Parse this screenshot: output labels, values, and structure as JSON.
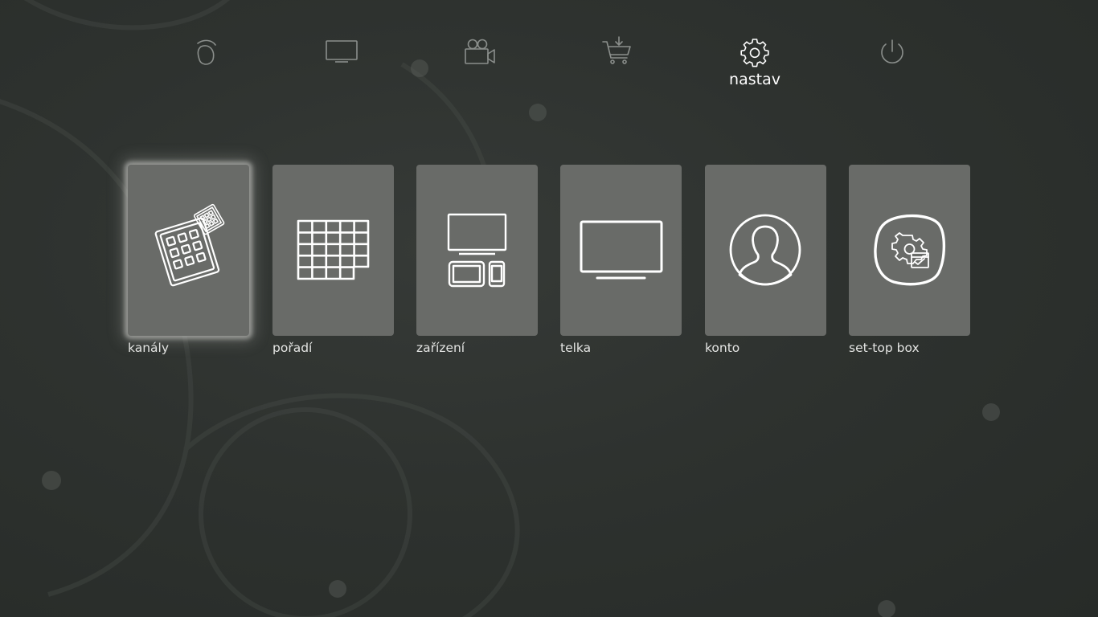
{
  "top_nav": {
    "items": [
      {
        "id": "home",
        "icon": "home-icon",
        "label": ""
      },
      {
        "id": "tv",
        "icon": "tv-icon",
        "label": ""
      },
      {
        "id": "video",
        "icon": "video-camera-icon",
        "label": ""
      },
      {
        "id": "store",
        "icon": "shopping-cart-icon",
        "label": ""
      },
      {
        "id": "settings",
        "icon": "gear-icon",
        "label": "nastav",
        "active": true
      },
      {
        "id": "power",
        "icon": "power-icon",
        "label": ""
      }
    ]
  },
  "tiles": [
    {
      "id": "channels",
      "icon": "channels-grid-icon",
      "label": "kanály",
      "selected": true
    },
    {
      "id": "order",
      "icon": "table-grid-icon",
      "label": "pořadí"
    },
    {
      "id": "devices",
      "icon": "devices-icon",
      "label": "zařízení"
    },
    {
      "id": "tv",
      "icon": "tv-screen-icon",
      "label": "telka"
    },
    {
      "id": "account",
      "icon": "user-icon",
      "label": "konto"
    },
    {
      "id": "stb",
      "icon": "settop-box-settings-icon",
      "label": "set-top box"
    }
  ],
  "colors": {
    "background": "#2e322f",
    "tile": "#696b68",
    "nav_inactive": "#8b8f8c",
    "text": "#e3e4e2",
    "active": "#ffffff"
  }
}
